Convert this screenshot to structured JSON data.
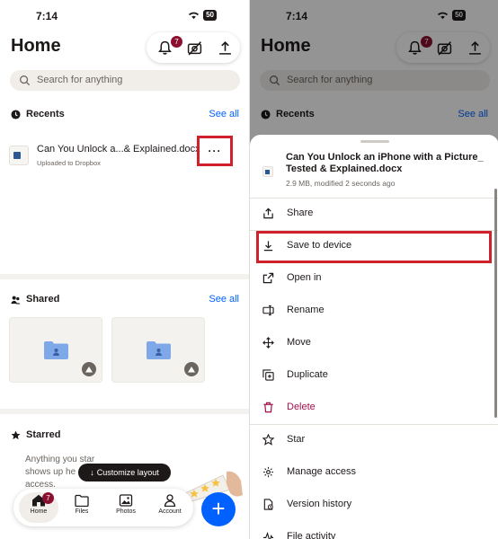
{
  "left": {
    "status": {
      "time": "7:14",
      "battery": "50"
    },
    "title": "Home",
    "notifications_count": "7",
    "search": {
      "placeholder": "Search for anything"
    },
    "recents": {
      "heading": "Recents",
      "see_all": "See all",
      "file": {
        "name": "Can You Unlock a...& Explained.docx",
        "subtitle": "Uploaded to Dropbox",
        "more_label": "···"
      }
    },
    "shared": {
      "heading": "Shared",
      "see_all": "See all"
    },
    "starred": {
      "heading": "Starred",
      "line1": "Anything you star",
      "line2": "shows up he",
      "line3": "access."
    },
    "customize_layout": "Customize layout",
    "tabs": [
      {
        "label": "Home",
        "badge": "7"
      },
      {
        "label": "Files"
      },
      {
        "label": "Photos"
      },
      {
        "label": "Account"
      }
    ],
    "fab_label": "+"
  },
  "right": {
    "status": {
      "time": "7:14",
      "battery": "50"
    },
    "title": "Home",
    "notifications_count": "7",
    "search": {
      "placeholder": "Search for anything"
    },
    "recents": {
      "heading": "Recents",
      "see_all": "See all"
    },
    "sheet": {
      "title": "Can You Unlock an iPhone with a Picture_ Tested & Explained.docx",
      "meta": "2.9 MB, modified 2 seconds ago",
      "items": [
        {
          "label": "Share",
          "icon": "share-icon"
        },
        {
          "label": "Save to device",
          "icon": "download-icon"
        },
        {
          "label": "Open in",
          "icon": "open-in-icon"
        },
        {
          "label": "Rename",
          "icon": "rename-icon"
        },
        {
          "label": "Move",
          "icon": "move-icon"
        },
        {
          "label": "Duplicate",
          "icon": "duplicate-icon"
        },
        {
          "label": "Delete",
          "icon": "trash-icon"
        },
        {
          "label": "Star",
          "icon": "star-icon"
        },
        {
          "label": "Manage access",
          "icon": "gear-icon"
        },
        {
          "label": "Version history",
          "icon": "version-history-icon"
        },
        {
          "label": "File activity",
          "icon": "activity-icon"
        }
      ]
    }
  },
  "colors": {
    "accent": "#0061fe",
    "badge": "#8b1030",
    "danger": "#a1114b",
    "highlight": "#d0202b"
  }
}
